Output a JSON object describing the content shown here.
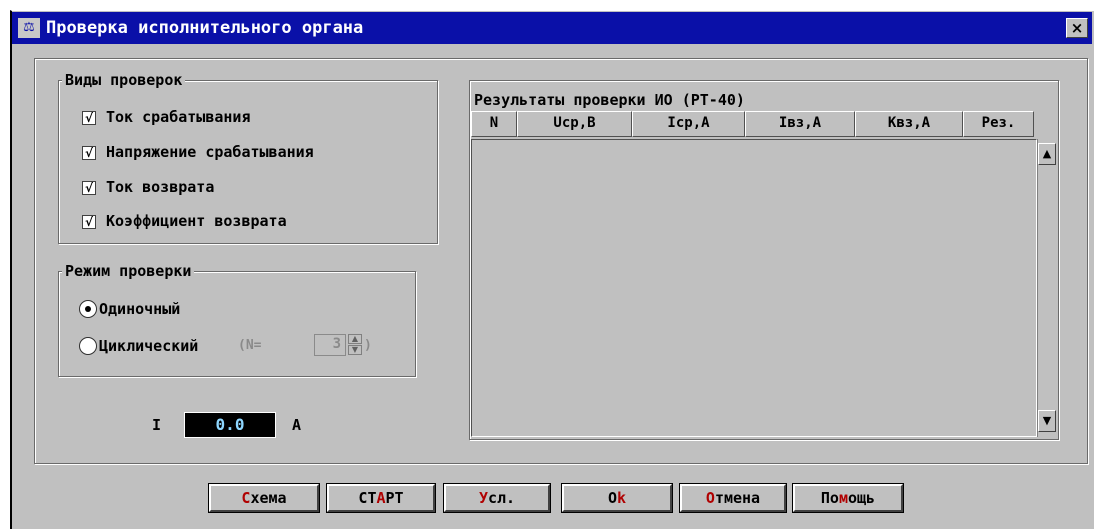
{
  "window": {
    "title": "Проверка исполнительного органа",
    "icon": "scales-icon",
    "close_label": "×"
  },
  "check_types": {
    "legend": "Виды проверок",
    "items": [
      {
        "label": "Ток срабатывания",
        "checked": true
      },
      {
        "label": "Напряжение срабатывания",
        "checked": true
      },
      {
        "label": "Ток возврата",
        "checked": true
      },
      {
        "label": "Коэффициент возврата",
        "checked": true
      }
    ],
    "check_mark": "√"
  },
  "check_mode": {
    "legend": "Режим проверки",
    "single_label": "Одиночный",
    "cyclic_label": "Циклический",
    "cyclic_param_prefix": "(N=",
    "cyclic_param_suffix": ")",
    "cyclic_count": "3",
    "selected": "single"
  },
  "current": {
    "label": "I",
    "value": "0.0",
    "unit": "A"
  },
  "results": {
    "title": "Результаты проверки ИО (РТ-40)",
    "columns": [
      "N",
      "Ucp,B",
      "Icp,A",
      "Iвз,A",
      "Kвз,A",
      "Рез."
    ],
    "rows": []
  },
  "buttons": {
    "scheme": {
      "hot": "С",
      "rest": "хема"
    },
    "start": {
      "pre": "СТ",
      "hot": "А",
      "rest": "РТ"
    },
    "conditions": {
      "hot": "У",
      "rest": "сл."
    },
    "ok": {
      "pre": "O",
      "hot": "k",
      "rest": ""
    },
    "cancel": {
      "hot": "О",
      "rest": "тмена"
    },
    "help": {
      "pre": "По",
      "hot": "м",
      "rest": "ощь"
    }
  }
}
